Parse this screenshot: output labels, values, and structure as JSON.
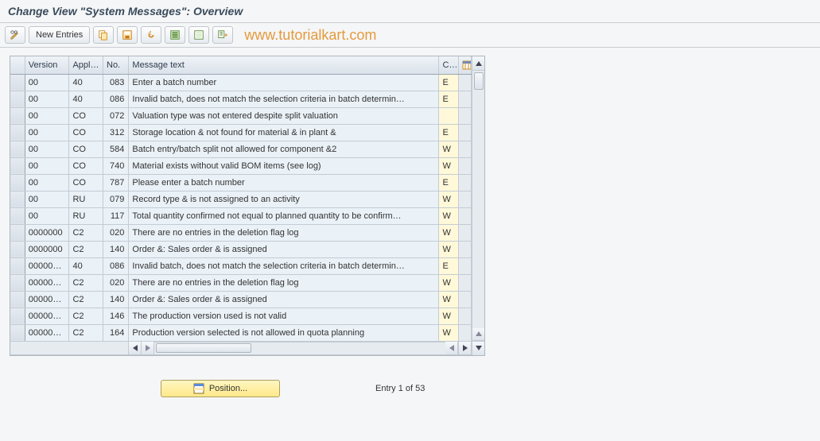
{
  "header": {
    "title": "Change View \"System Messages\": Overview"
  },
  "toolbar": {
    "new_entries_label": "New Entries"
  },
  "watermark": "www.tutorialkart.com",
  "grid": {
    "columns": {
      "version": "Version",
      "appl": "Appl.A.",
      "no": "No.",
      "message": "Message text",
      "cat": "Cat"
    },
    "rows": [
      {
        "version": "00",
        "appl": "40",
        "no": "083",
        "msg": "Enter a batch number",
        "cat": "E"
      },
      {
        "version": "00",
        "appl": "40",
        "no": "086",
        "msg": "Invalid batch, does not match the selection criteria in batch determin…",
        "cat": "E"
      },
      {
        "version": "00",
        "appl": "CO",
        "no": "072",
        "msg": "Valuation type was not entered despite split valuation",
        "cat": ""
      },
      {
        "version": "00",
        "appl": "CO",
        "no": "312",
        "msg": "Storage location & not found for material & in plant &",
        "cat": "E"
      },
      {
        "version": "00",
        "appl": "CO",
        "no": "584",
        "msg": "Batch entry/batch split not allowed for component &2",
        "cat": "W"
      },
      {
        "version": "00",
        "appl": "CO",
        "no": "740",
        "msg": "Material exists without valid BOM items (see log)",
        "cat": "W"
      },
      {
        "version": "00",
        "appl": "CO",
        "no": "787",
        "msg": "Please enter a batch number",
        "cat": "E"
      },
      {
        "version": "00",
        "appl": "RU",
        "no": "079",
        "msg": "Record type & is not assigned to an activity",
        "cat": "W"
      },
      {
        "version": "00",
        "appl": "RU",
        "no": "117",
        "msg": "Total quantity confirmed not equal to planned quantity to be confirm…",
        "cat": "W"
      },
      {
        "version": "0000000",
        "appl": "C2",
        "no": "020",
        "msg": "There are no entries in the deletion flag log",
        "cat": "W"
      },
      {
        "version": "0000000",
        "appl": "C2",
        "no": "140",
        "msg": "Order &: Sales order & is assigned",
        "cat": "W"
      },
      {
        "version": "000000…",
        "appl": "40",
        "no": "086",
        "msg": "Invalid batch, does not match the selection criteria in batch determin…",
        "cat": "E"
      },
      {
        "version": "000000…",
        "appl": "C2",
        "no": "020",
        "msg": "There are no entries in the deletion flag log",
        "cat": "W"
      },
      {
        "version": "000000…",
        "appl": "C2",
        "no": "140",
        "msg": "Order &: Sales order & is assigned",
        "cat": "W"
      },
      {
        "version": "000000…",
        "appl": "C2",
        "no": "146",
        "msg": "The production version used is not valid",
        "cat": "W"
      },
      {
        "version": "000000…",
        "appl": "C2",
        "no": "164",
        "msg": "Production version selected is not allowed in quota planning",
        "cat": "W"
      }
    ]
  },
  "footer": {
    "position_label": "Position...",
    "entry_text": "Entry 1 of 53"
  }
}
